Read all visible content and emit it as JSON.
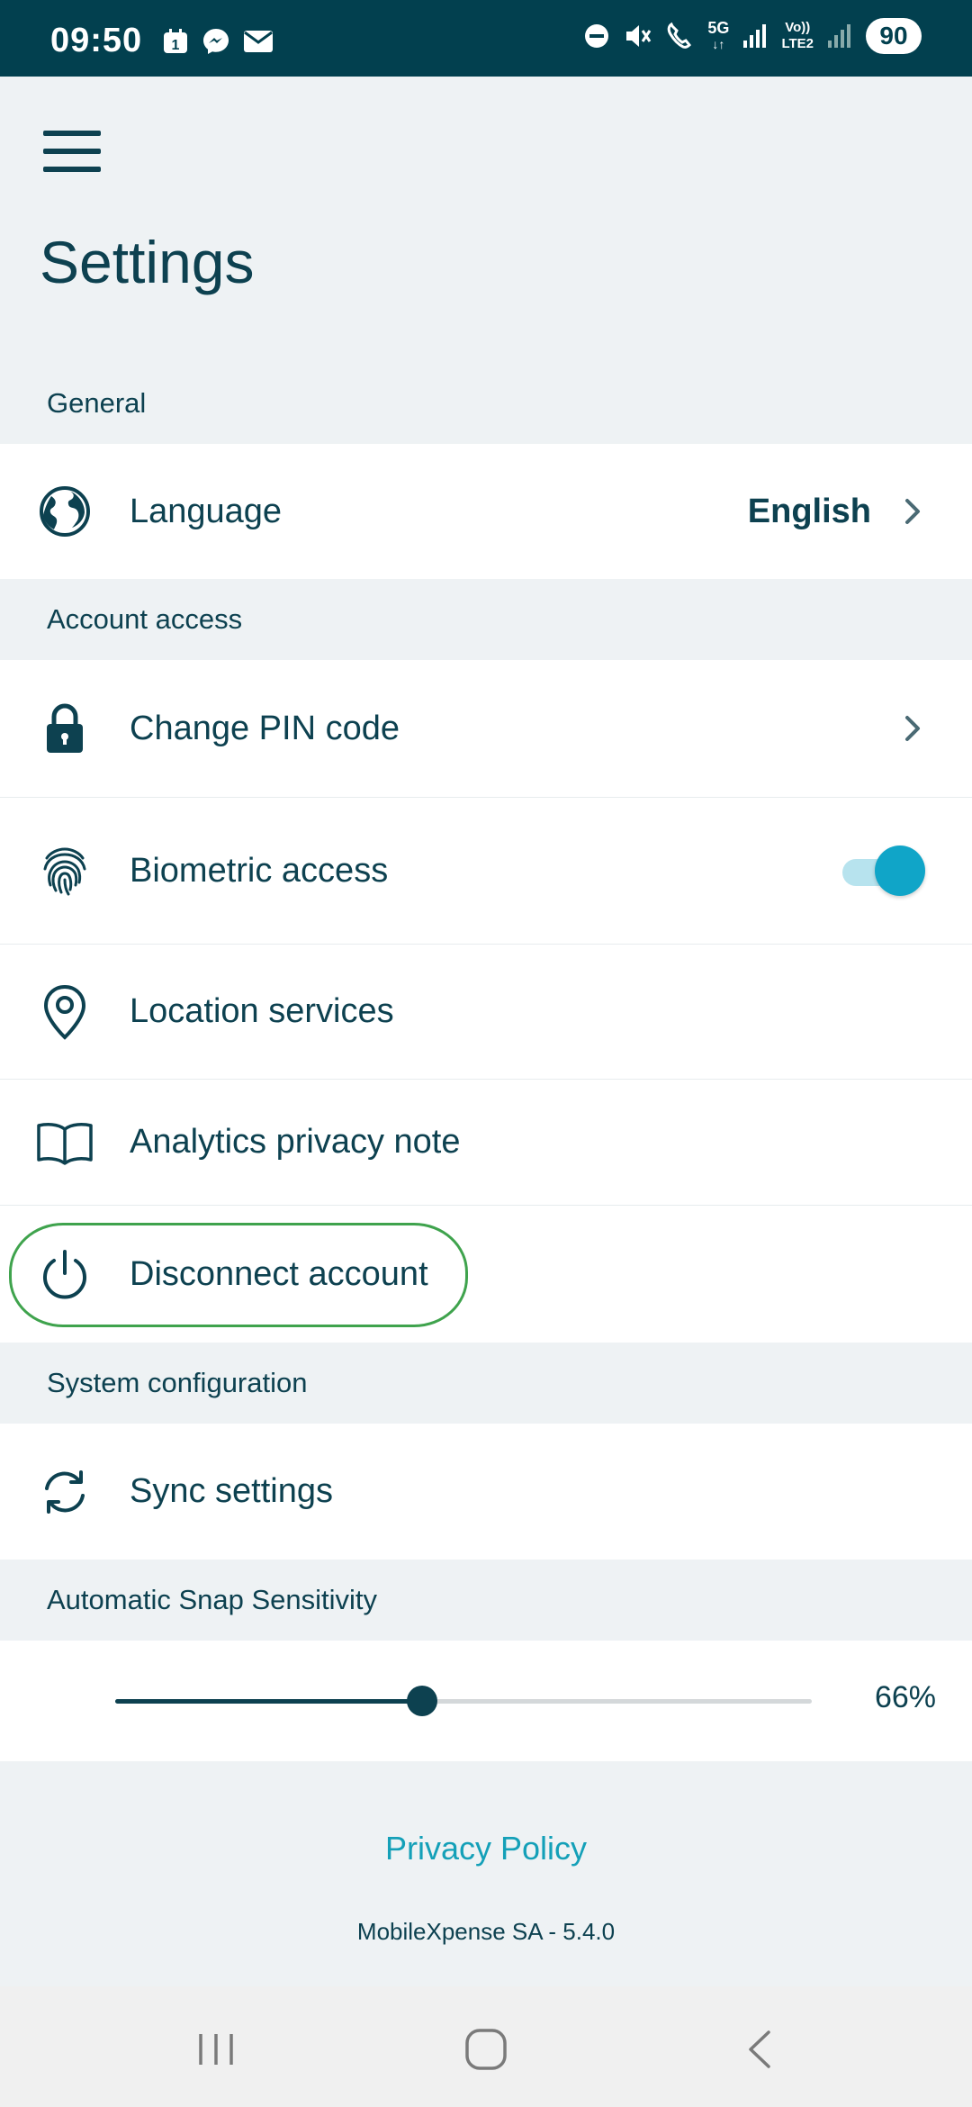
{
  "status_bar": {
    "time": "09:50",
    "calendar_badge": "1",
    "network_5g": "5G",
    "volte_top": "Vo))",
    "volte_bottom": "LTE2",
    "battery": "90",
    "icons": [
      "calendar-icon",
      "messenger-icon",
      "mail-icon",
      "dnd-icon",
      "mute-icon",
      "wifi-calling-icon",
      "signal-icon",
      "signal-icon"
    ]
  },
  "header": {
    "title": "Settings"
  },
  "sections": {
    "general": "General",
    "account_access": "Account access",
    "system_configuration": "System configuration",
    "snap_sensitivity": "Automatic Snap Sensitivity"
  },
  "rows": {
    "language": {
      "label": "Language",
      "value": "English",
      "icon": "globe-icon"
    },
    "change_pin": {
      "label": "Change PIN code",
      "icon": "lock-icon"
    },
    "biometric": {
      "label": "Biometric access",
      "icon": "fingerprint-icon",
      "enabled": true
    },
    "location": {
      "label": "Location services",
      "icon": "location-pin-icon"
    },
    "analytics": {
      "label": "Analytics privacy note",
      "icon": "book-icon"
    },
    "disconnect": {
      "label": "Disconnect account",
      "icon": "power-icon"
    },
    "sync": {
      "label": "Sync settings",
      "icon": "sync-icon"
    }
  },
  "slider": {
    "value_label": "66%",
    "fraction": 0.44
  },
  "footer": {
    "privacy_policy": "Privacy Policy",
    "version": "MobileXpense SA - 5.4.0"
  },
  "colors": {
    "primary": "#0d4150",
    "accent": "#10a5c8",
    "link": "#14a0b8",
    "status_bar": "#02404f",
    "highlight": "#3fa34d"
  }
}
